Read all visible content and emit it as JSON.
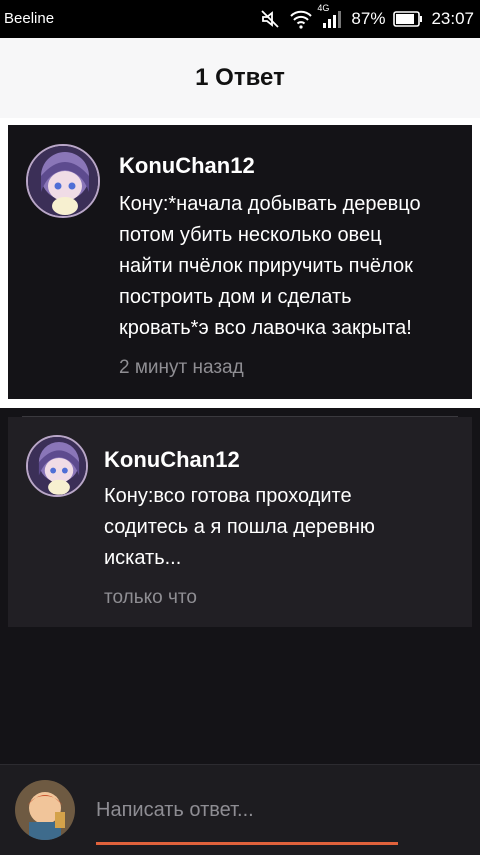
{
  "status_bar": {
    "carrier": "Beeline",
    "network": "4G",
    "battery": "87%",
    "time": "23:07"
  },
  "header": {
    "title": "1 Ответ"
  },
  "parent_comment": {
    "username": "KonuChan12",
    "message_lines": [
      "Кону:*начала добывать деревцо",
      "потом убить несколько овец",
      "найти пчёлок приручить пчёлок",
      "построить дом и сделать",
      "кровать*э всо лавочка закрыта!"
    ],
    "time": "2 минут назад"
  },
  "reply": {
    "username": "KonuChan12",
    "message_lines": [
      "Кону:всо готова проходите",
      "содитесь а я пошла деревню",
      "искать..."
    ],
    "time": "только что"
  },
  "composer": {
    "placeholder": "Написать ответ..."
  },
  "colors": {
    "accent": "#e0623c",
    "background": "#141317",
    "card": "#211f24"
  },
  "icons": [
    "mute-icon",
    "wifi-icon",
    "signal-icon",
    "battery-icon",
    "send-icon"
  ]
}
